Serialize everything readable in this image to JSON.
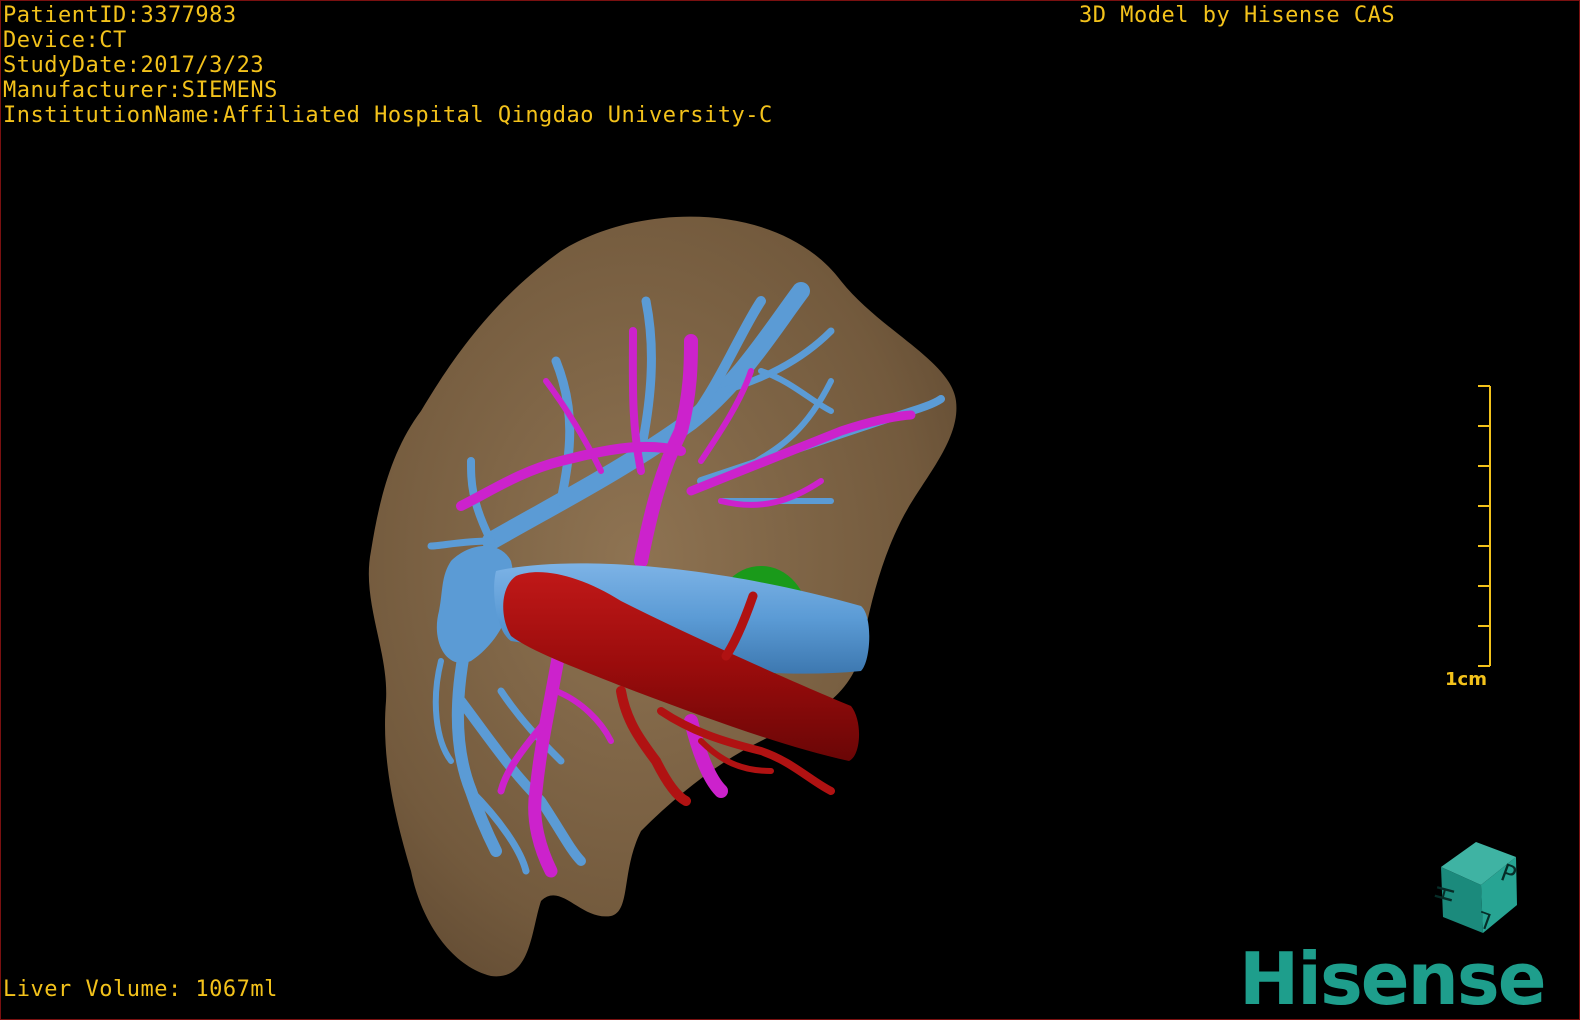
{
  "overlay": {
    "patient_id": "PatientID:3377983",
    "device": "Device:CT",
    "study_date": "StudyDate:2017/3/23",
    "manufacturer": "Manufacturer:SIEMENS",
    "institution": "InstitutionName:Affiliated Hospital Qingdao University-C",
    "credit": "3D Model by Hisense CAS",
    "liver_volume": "Liver Volume: 1067ml"
  },
  "scale_bar": {
    "label": "1cm",
    "ticks": 8
  },
  "orientation_cube": {
    "faces": [
      "P",
      "H",
      "L"
    ]
  },
  "brand": {
    "name": "Hisense"
  },
  "colors": {
    "text": "#f3c21b",
    "liver": "#7e6446",
    "hepatic_vein": "#5b9bd5",
    "portal_vein": "#cc22cc",
    "artery": "#a50f0f",
    "gallbladder": "#1a9a1a",
    "brand": "#1e9e8c"
  }
}
